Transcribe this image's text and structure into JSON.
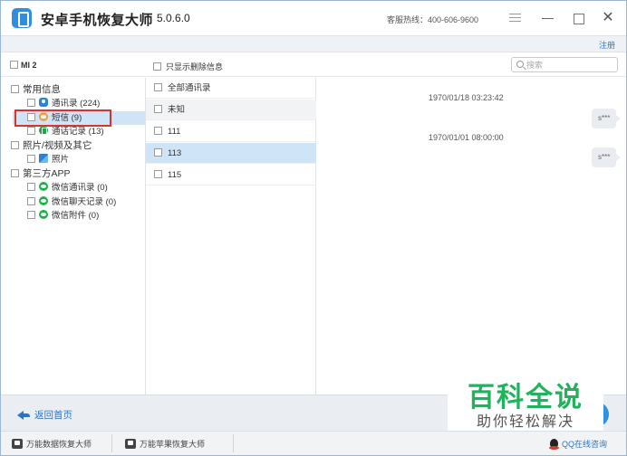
{
  "window": {
    "title": "安卓手机恢复大师",
    "version": "5.0.6.0",
    "hotline": "客服热线：400-606-9600",
    "register": "注册"
  },
  "toolbar": {
    "device": "MI 2",
    "only_deleted": "只显示删除信息",
    "search_placeholder": "搜索"
  },
  "tree": {
    "groups": [
      {
        "label": "常用信息",
        "items": [
          "通讯录 (224)",
          "短信 (9)",
          "通话记录 (13)"
        ]
      },
      {
        "label": "照片/视频及其它",
        "items": [
          "照片"
        ]
      },
      {
        "label": "第三方APP",
        "items": [
          "微信通讯录 (0)",
          "微信聊天记录 (0)",
          "微信附件 (0)"
        ]
      }
    ]
  },
  "contacts_list": [
    "全部通讯录",
    "未知",
    "111",
    "113",
    "115"
  ],
  "messages": [
    {
      "time": "1970/01/18 03:23:42",
      "text": "s***"
    },
    {
      "time": "1970/01/01 08:00:00",
      "text": "s***"
    }
  ],
  "footer": {
    "back_home": "返回首页"
  },
  "watermark": {
    "title": "百科全说",
    "subtitle": "助你轻松解决"
  },
  "bottombar": {
    "data_recovery": "万能数据恢复大师",
    "apple_recovery": "万能苹果恢复大师",
    "qq_support": "QQ在线咨询"
  },
  "colors": {
    "accent": "#2a74c8",
    "selection": "#cfe4f7",
    "highlight_box": "#d9342b",
    "watermark": "#20b35c"
  }
}
